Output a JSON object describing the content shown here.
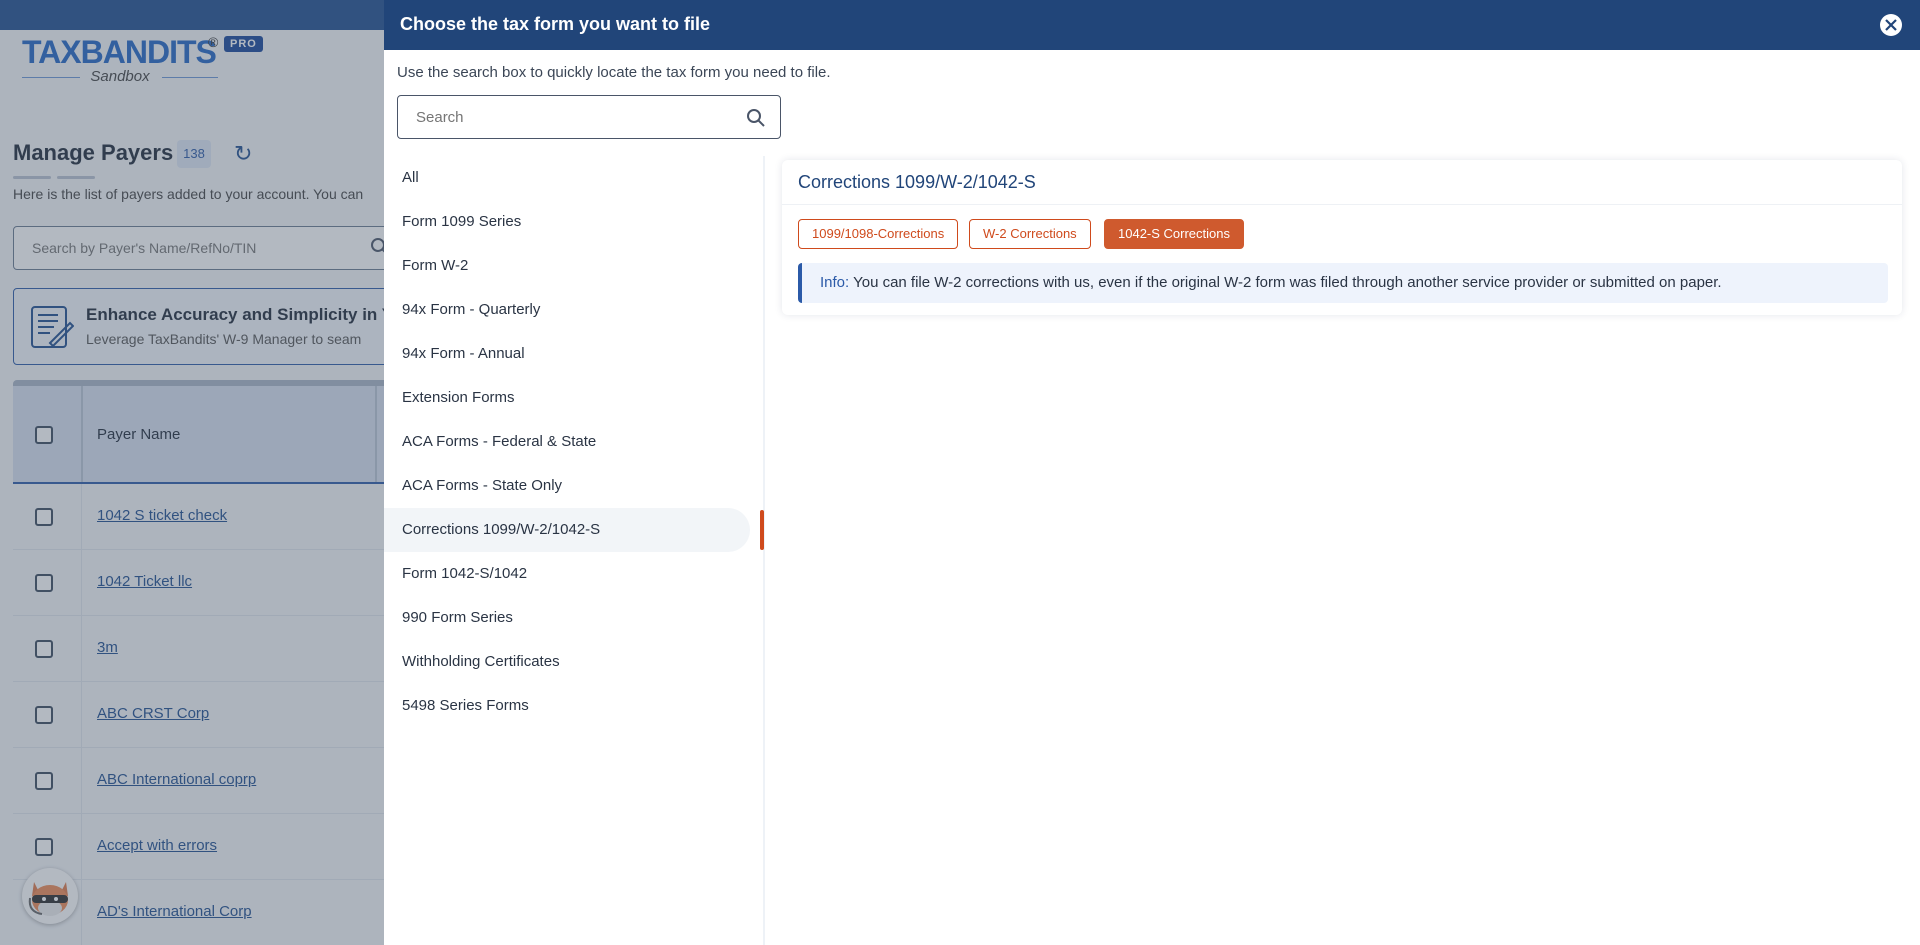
{
  "app": {
    "logo_text": "TAXBANDITS",
    "logo_badge": "PRO",
    "logo_sub": "Sandbox",
    "registered_mark": "®"
  },
  "background_page": {
    "title": "Manage Payers",
    "count": "138",
    "description": "Here is the list of payers added to your account. You can",
    "search_placeholder": "Search by Payer's Name/RefNo/TIN",
    "banner": {
      "title": "Enhance Accuracy and Simplicity in Your",
      "subtitle": "Leverage TaxBandits' W-9 Manager to seam"
    },
    "table": {
      "header": "Payer Name",
      "rows": [
        "1042 S ticket check",
        "1042 Ticket llc",
        "3m",
        "ABC CRST Corp",
        "ABC International coprp",
        "Accept with errors",
        "AD's International Corp"
      ]
    }
  },
  "modal": {
    "title": "Choose the tax form you want to file",
    "hint": "Use the search box to quickly locate the tax form you need to file.",
    "search_placeholder": "Search",
    "search_value": "",
    "categories": [
      {
        "label": "All",
        "active": false
      },
      {
        "label": "Form 1099 Series",
        "active": false
      },
      {
        "label": "Form W-2",
        "active": false
      },
      {
        "label": "94x Form - Quarterly",
        "active": false
      },
      {
        "label": "94x Form - Annual",
        "active": false
      },
      {
        "label": "Extension Forms",
        "active": false
      },
      {
        "label": "ACA Forms - Federal & State",
        "active": false
      },
      {
        "label": "ACA Forms - State Only",
        "active": false
      },
      {
        "label": "Corrections 1099/W-2/1042-S",
        "active": true
      },
      {
        "label": "Form 1042-S/1042",
        "active": false
      },
      {
        "label": "990 Form Series",
        "active": false
      },
      {
        "label": "Withholding Certificates",
        "active": false
      },
      {
        "label": "5498 Series Forms",
        "active": false
      }
    ],
    "panel": {
      "title": "Corrections 1099/W-2/1042-S",
      "buttons": [
        {
          "label": "1099/1098-Corrections",
          "active": false
        },
        {
          "label": "W-2 Corrections",
          "active": false
        },
        {
          "label": "1042-S Corrections",
          "active": true
        }
      ],
      "info_label": "Info:",
      "info_text": "You can file W-2 corrections with us, even if the original W-2 form was filed through another service provider or submitted on paper."
    }
  },
  "colors": {
    "header_bg": "#214579",
    "accent_orange": "#cf4a1c",
    "info_border": "#2b5aa8",
    "link": "#1f4e8f"
  }
}
